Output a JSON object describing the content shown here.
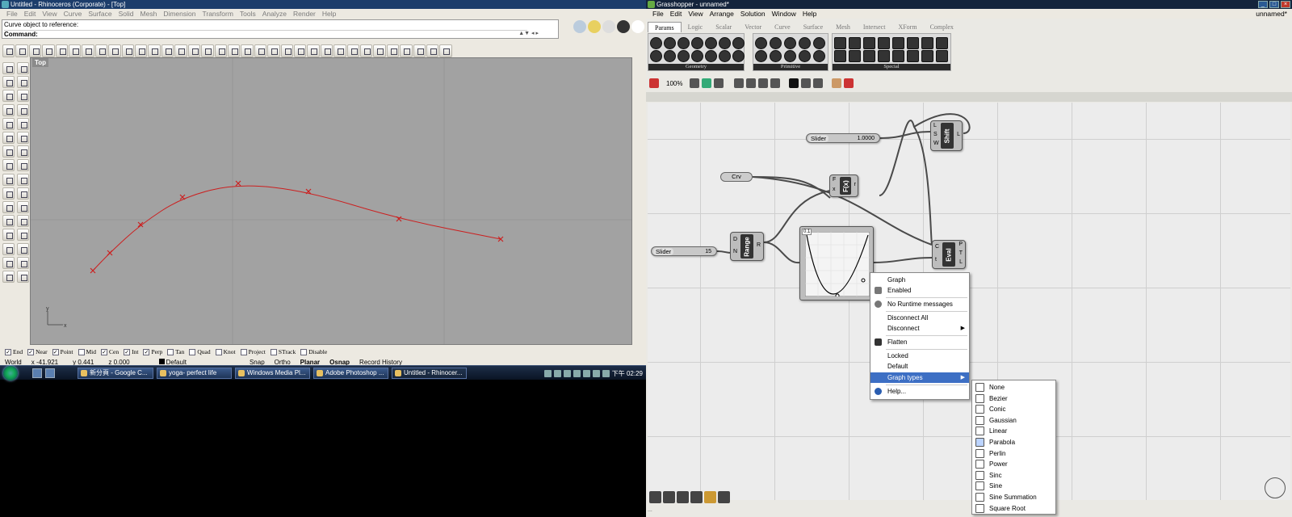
{
  "rhino": {
    "title": "Untitled - Rhinoceros (Corporate) - [Top]",
    "menu": [
      "File",
      "Edit",
      "View",
      "Curve",
      "Surface",
      "Solid",
      "Mesh",
      "Dimension",
      "Transform",
      "Tools",
      "Analyze",
      "Render",
      "Help"
    ],
    "command_history": "Curve object to reference:",
    "command_label": "Command:",
    "viewport_name": "Top",
    "axis_x": "x",
    "axis_y": "y",
    "osnap": [
      {
        "label": "End",
        "checked": true
      },
      {
        "label": "Near",
        "checked": true
      },
      {
        "label": "Point",
        "checked": true
      },
      {
        "label": "Mid",
        "checked": false
      },
      {
        "label": "Cen",
        "checked": true
      },
      {
        "label": "Int",
        "checked": true
      },
      {
        "label": "Perp",
        "checked": true
      },
      {
        "label": "Tan",
        "checked": false
      },
      {
        "label": "Quad",
        "checked": false
      },
      {
        "label": "Knot",
        "checked": false
      },
      {
        "label": "Project",
        "checked": false
      },
      {
        "label": "STrack",
        "checked": false
      },
      {
        "label": "Disable",
        "checked": false
      }
    ],
    "status": {
      "cplane": "World",
      "x": "x -41.921",
      "y": "y 0.441",
      "z": "z 0.000",
      "layer": "Default",
      "snap": "Snap",
      "ortho": "Ortho",
      "planar": "Planar",
      "osnap": "Osnap",
      "record_history": "Record History"
    },
    "curve_color": "#cc1f1f"
  },
  "taskbar": {
    "tasks": [
      "新分頁 - Google C...",
      "yoga- perfect life",
      "Windows Media Pl...",
      "Adobe Photoshop ...",
      "Untitled - Rhinocer..."
    ],
    "clock": "下午 02:29"
  },
  "gh": {
    "title": "Grasshopper - unnamed*",
    "doc_name": "unnamed*",
    "menu": [
      "File",
      "Edit",
      "View",
      "Arrange",
      "Solution",
      "Window",
      "Help"
    ],
    "tabs": [
      "Params",
      "Logic",
      "Scalar",
      "Vector",
      "Curve",
      "Surface",
      "Mesh",
      "Intersect",
      "XForm",
      "Complex"
    ],
    "groups": [
      "Geometry",
      "Primitive",
      "Special"
    ],
    "zoom": "100%",
    "components": {
      "slider1": {
        "label": "Slider",
        "value": "1.0000"
      },
      "crv": "Crv",
      "fx": {
        "name": "F(x)",
        "inputs": [
          "F",
          "x"
        ],
        "outputs": [
          "r"
        ]
      },
      "shift": {
        "name": "Shift",
        "inputs": [
          "L",
          "S",
          "W"
        ],
        "outputs": [
          "L"
        ]
      },
      "slider2": {
        "label": "Slider",
        "value": "15"
      },
      "range": {
        "name": "Range",
        "inputs": [
          "D",
          "N"
        ],
        "outputs": [
          "R"
        ]
      },
      "graph_tag": "0.1",
      "eval": {
        "name": "Eval",
        "inputs": [
          "C",
          "t"
        ],
        "outputs": [
          "P",
          "T",
          "L"
        ]
      }
    },
    "context_menu": {
      "items": [
        "Graph",
        "Enabled",
        "No Runtime messages",
        "Disconnect All",
        "Disconnect",
        "Flatten",
        "Locked",
        "Default",
        "Graph types",
        "Help..."
      ]
    },
    "graph_types": [
      "None",
      "Bezier",
      "Conic",
      "Gaussian",
      "Linear",
      "Parabola",
      "Perlin",
      "Power",
      "Sinc",
      "Sine",
      "Sine Summation",
      "Square Root"
    ],
    "selected_graph_type": "Parabola",
    "footer": "..."
  }
}
